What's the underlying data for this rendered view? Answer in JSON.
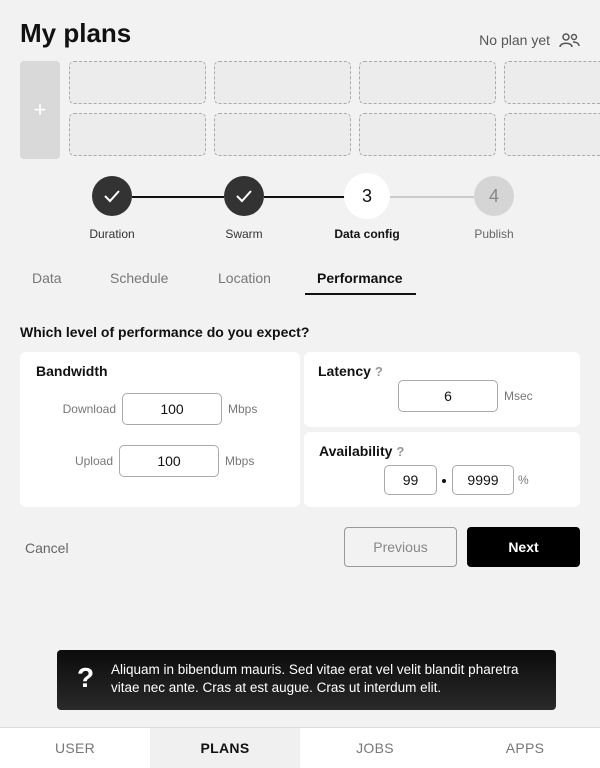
{
  "header": {
    "title": "My plans",
    "status": "No plan yet",
    "status_icon": "user-icon"
  },
  "plans_grid": {
    "add_label": "+",
    "slots_per_row": 4,
    "rows": 2
  },
  "stepper": {
    "steps": [
      {
        "label": "Duration",
        "state": "done",
        "marker": "check"
      },
      {
        "label": "Swarm",
        "state": "done",
        "marker": "check"
      },
      {
        "label": "Data config",
        "state": "current",
        "marker": "3"
      },
      {
        "label": "Publish",
        "state": "future",
        "marker": "4"
      }
    ]
  },
  "tabs": [
    {
      "label": "Data",
      "active": false
    },
    {
      "label": "Schedule",
      "active": false
    },
    {
      "label": "Location",
      "active": false
    },
    {
      "label": "Performance",
      "active": true
    }
  ],
  "form": {
    "question": "Which level of performance do you expect?",
    "bandwidth": {
      "title": "Bandwidth",
      "download_label": "Download",
      "download_value": "100",
      "download_unit": "Mbps",
      "upload_label": "Upload",
      "upload_value": "100",
      "upload_unit": "Mbps"
    },
    "latency": {
      "title": "Latency",
      "help": "?",
      "value": "6",
      "unit": "Msec"
    },
    "availability": {
      "title": "Availability",
      "help": "?",
      "value_major": "99",
      "value_minor": "9999",
      "unit": "%"
    }
  },
  "actions": {
    "cancel": "Cancel",
    "previous": "Previous",
    "next": "Next"
  },
  "toast": {
    "icon": "?",
    "text": "Aliquam in bibendum mauris. Sed vitae erat vel velit blandit pharetra vitae nec ante. Cras at est augue. Cras ut interdum elit."
  },
  "bottom_nav": [
    {
      "label": "USER",
      "active": false
    },
    {
      "label": "PLANS",
      "active": true
    },
    {
      "label": "JOBS",
      "active": false
    },
    {
      "label": "APPS",
      "active": false
    }
  ],
  "colors": {
    "background": "#f2f2f2",
    "step_done": "#333333",
    "primary_button": "#000000"
  }
}
